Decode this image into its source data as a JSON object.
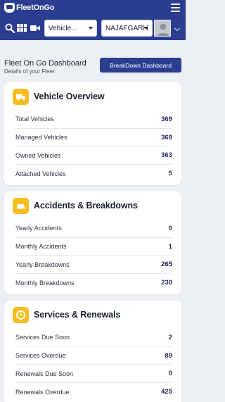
{
  "app": {
    "logo_text": "FleetOnGo"
  },
  "toolbar": {
    "vehicle_select": "Vehicle...",
    "location_select": "NAJAFGARH"
  },
  "header": {
    "title": "Fleet On Go Dashboard",
    "subtitle": "Details of your Fleet",
    "breakdown_button": "BreakDown Dashboard"
  },
  "colors": {
    "brand": "#2b3d91",
    "accent": "#f5bd1f",
    "value": "#1f2555"
  },
  "sections": [
    {
      "title": "Vehicle Overview",
      "icon": "truck-icon",
      "rows": [
        {
          "label": "Total Vehicles",
          "value": "369"
        },
        {
          "label": "Managed Vehicles",
          "value": "369"
        },
        {
          "label": "Owned Vehicles",
          "value": "363"
        },
        {
          "label": "Attached Vehicles",
          "value": "5"
        }
      ]
    },
    {
      "title": "Accidents & Breakdowns",
      "icon": "car-crash-icon",
      "rows": [
        {
          "label": "Yearly Accidents",
          "value": "0"
        },
        {
          "label": "Monthly Accidents",
          "value": "1"
        },
        {
          "label": "Yearly Breakdowns",
          "value": "265"
        },
        {
          "label": "Monthly Breakdowns",
          "value": "230"
        }
      ]
    },
    {
      "title": "Services & Renewals",
      "icon": "clock-icon",
      "rows": [
        {
          "label": "Services Due Soon",
          "value": "2"
        },
        {
          "label": "Services Overdue",
          "value": "89"
        },
        {
          "label": "Renewals Due Soon",
          "value": "0"
        },
        {
          "label": "Renewals Overdue",
          "value": "425"
        }
      ]
    }
  ]
}
